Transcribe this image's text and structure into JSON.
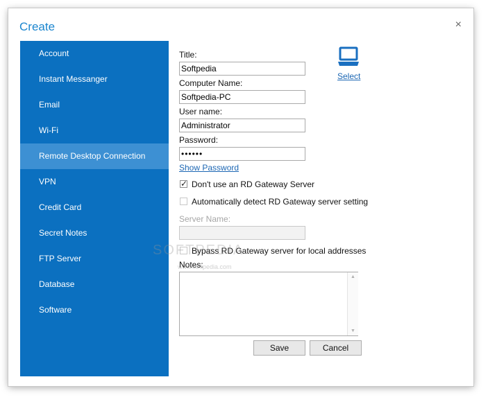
{
  "window": {
    "title": "Create",
    "close_glyph": "×"
  },
  "sidebar": {
    "items": [
      {
        "label": "Account"
      },
      {
        "label": "Instant Messanger"
      },
      {
        "label": "Email"
      },
      {
        "label": "Wi-Fi"
      },
      {
        "label": "Remote Desktop Connection",
        "active": true
      },
      {
        "label": "VPN"
      },
      {
        "label": "Credit Card"
      },
      {
        "label": "Secret Notes"
      },
      {
        "label": "FTP Server"
      },
      {
        "label": "Database"
      },
      {
        "label": "Software"
      }
    ]
  },
  "form": {
    "title_label": "Title:",
    "title_value": "Softpedia",
    "computer_label": "Computer Name:",
    "computer_value": "Softpedia-PC",
    "user_label": "User name:",
    "user_value": "Administrator",
    "password_label": "Password:",
    "password_value": "••••••",
    "show_password": "Show Password",
    "select_icon": "computer-icon",
    "select_label": "Select",
    "no_gateway_label": "Don't use an RD Gateway Server",
    "no_gateway_checked": true,
    "auto_detect_label": "Automatically detect RD Gateway server setting",
    "auto_detect_checked": false,
    "server_label": "Server Name:",
    "server_value": "",
    "bypass_label": "Bypass RD Gateway server for local addresses",
    "bypass_checked": false,
    "notes_label": "Notes:",
    "notes_value": "",
    "check_glyph": "✓"
  },
  "buttons": {
    "save": "Save",
    "cancel": "Cancel"
  },
  "watermark": {
    "text": "SOFTPEDIA",
    "url": "www.softpedia.com"
  },
  "colors": {
    "accent": "#1b86cf",
    "sidebar_bg": "#0b70c0",
    "sidebar_active": "#3d90d3",
    "link": "#1b66b3",
    "icon_blue": "#1a6fc0"
  }
}
